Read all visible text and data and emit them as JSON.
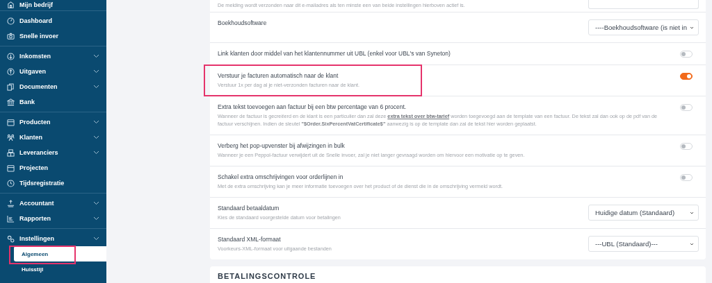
{
  "sidebar": {
    "groups": [
      {
        "items": [
          {
            "label": "Mijn bedrijf",
            "expandable": false,
            "selected": false
          }
        ]
      },
      {
        "items": [
          {
            "label": "Dashboard",
            "expandable": false,
            "selected": false
          },
          {
            "label": "Snelle invoer",
            "expandable": false,
            "selected": false
          }
        ]
      },
      {
        "items": [
          {
            "label": "Inkomsten",
            "expandable": true,
            "selected": false
          },
          {
            "label": "Uitgaven",
            "expandable": true,
            "selected": false
          },
          {
            "label": "Documenten",
            "expandable": true,
            "selected": false
          },
          {
            "label": "Bank",
            "expandable": false,
            "selected": false
          }
        ]
      },
      {
        "items": [
          {
            "label": "Producten",
            "expandable": true,
            "selected": false
          },
          {
            "label": "Klanten",
            "expandable": true,
            "selected": false
          },
          {
            "label": "Leveranciers",
            "expandable": true,
            "selected": false
          },
          {
            "label": "Projecten",
            "expandable": false,
            "selected": false
          },
          {
            "label": "Tijdsregistratie",
            "expandable": false,
            "selected": false
          }
        ]
      },
      {
        "items": [
          {
            "label": "Accountant",
            "expandable": true,
            "selected": false
          },
          {
            "label": "Rapporten",
            "expandable": true,
            "selected": false
          }
        ]
      },
      {
        "items": [
          {
            "label": "Instellingen",
            "expandable": true,
            "selected": false,
            "children": [
              {
                "label": "Algemeen",
                "selected": true,
                "highlighted": true
              },
              {
                "label": "Huisstijl",
                "selected": false,
                "highlighted": false
              }
            ]
          }
        ]
      }
    ]
  },
  "settings": {
    "rows": [
      {
        "kind": "input",
        "description": [
          {
            "kind": "text",
            "text": "De melding wordt verzonden naar dit e-mailadres als ten minste een van beide instellingen hierboven actief is."
          }
        ]
      },
      {
        "kind": "select",
        "title": "Boekhoudsoftware",
        "value": "----Boekhoudsoftware (is niet in"
      },
      {
        "kind": "toggle",
        "title": "Link klanten door middel van het klantennummer uit UBL (enkel voor UBL's van Syneton)",
        "on": false
      },
      {
        "kind": "toggle",
        "title": "Verstuur je facturen automatisch naar de klant",
        "description": [
          {
            "kind": "text",
            "text": "Verstuur 1x per dag al je niet-verzonden facturen naar de klant."
          }
        ],
        "on": true,
        "highlighted": true
      },
      {
        "kind": "toggle",
        "title": "Extra tekst toevoegen aan factuur bij een btw percentage van 6 procent.",
        "description": [
          {
            "kind": "text",
            "text": "Wanneer de factuur is gecreëerd en de klant is een particulier dan zal deze "
          },
          {
            "kind": "link",
            "text": "extra tekst over btw-tarief"
          },
          {
            "kind": "text",
            "text": " worden toegevoegd aan de template van een factuur. De tekst zal dan ook op de pdf van de factuur verschijnen. Indien de sleutel **\"$Order.SixPercentVatCertificate$\"** aanwezig is op de template dan zal de tekst hier worden geplaatst."
          }
        ],
        "on": false
      },
      {
        "kind": "toggle",
        "title": "Verberg het pop-upvenster bij afwijzingen in bulk",
        "description": [
          {
            "kind": "text",
            "text": "Wanneer je een Peppol-factuur verwijdert uit de Snelle invoer, zal je niet langer gevraagd worden om hiervoor een motivatie op te geven."
          }
        ],
        "on": false
      },
      {
        "kind": "toggle",
        "title": "Schakel extra omschrijvingen voor orderlijnen in",
        "description": [
          {
            "kind": "text",
            "text": "Met de extra omschrijving kan je meer informatie toevoegen over het product of de dienst die in de omschrijving vermeld wordt."
          }
        ],
        "on": false
      },
      {
        "kind": "select",
        "title": "Standaard betaaldatum",
        "description": [
          {
            "kind": "text",
            "text": "Kies de standaard voorgestelde datum voor betalingen"
          }
        ],
        "value": "Huidige datum (Standaard)"
      },
      {
        "kind": "select",
        "title": "Standaard XML-formaat",
        "description": [
          {
            "kind": "text",
            "text": "Voorkeurs-XML-formaat voor uitgaande bestanden"
          }
        ],
        "value": "---UBL (Standaard)---"
      }
    ]
  },
  "next_section": {
    "title": "BETALINGSCONTROLE"
  }
}
